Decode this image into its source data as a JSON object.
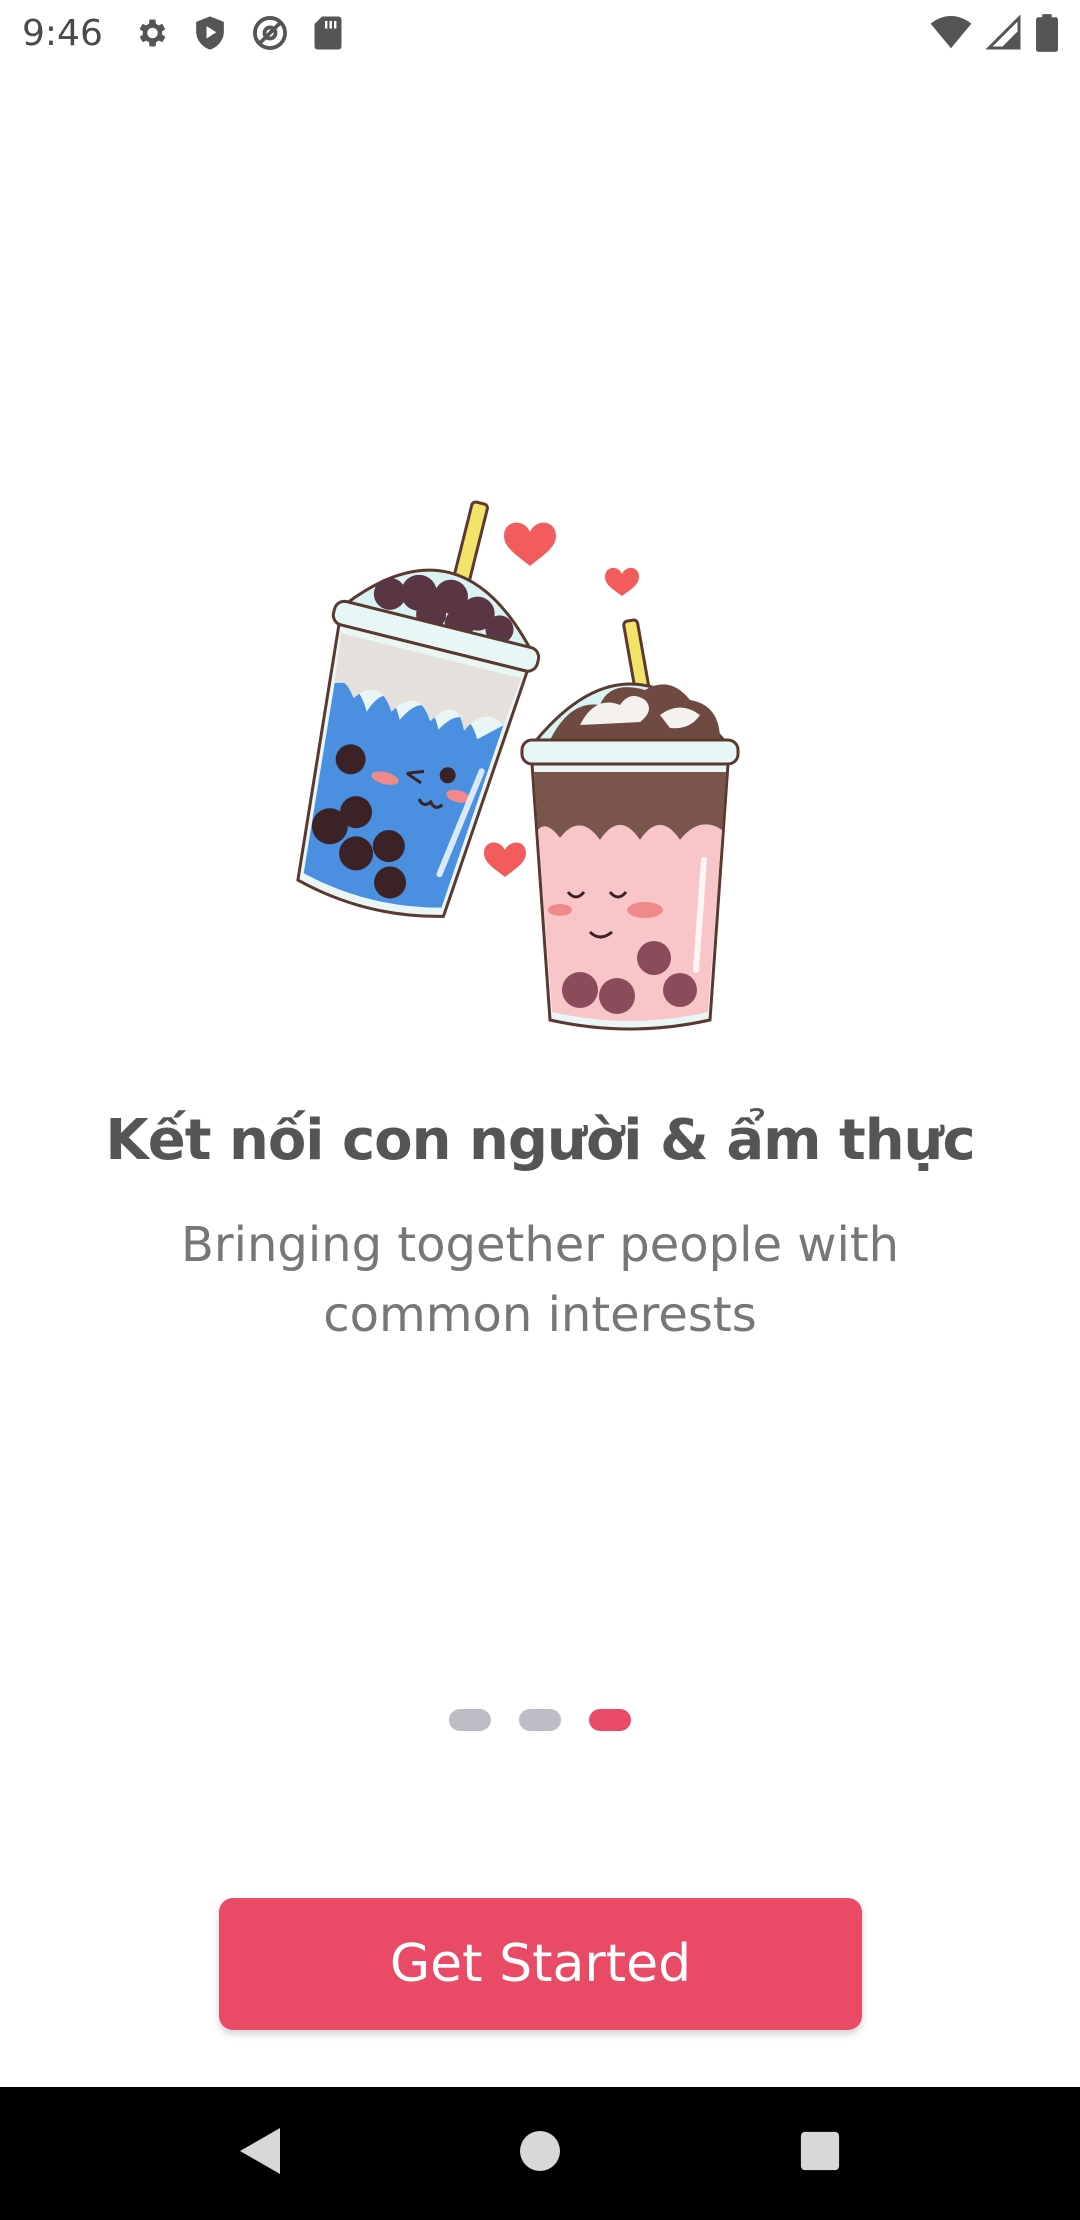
{
  "status_bar": {
    "time": "9:46",
    "left_icons": [
      "gear-icon",
      "shield-play-icon",
      "at-sync-icon",
      "sd-card-icon"
    ],
    "right_icons": [
      "wifi-icon",
      "signal-icon",
      "battery-icon"
    ]
  },
  "illustration": {
    "name": "bubble-tea-cups-illustration",
    "colors": {
      "blue_drink": "#4a8fe0",
      "pink_drink": "#f8c6c9",
      "chocolate": "#7a554c",
      "pearls": "#3a2226",
      "heart": "#f25c5c",
      "straw": "#f2e36a"
    }
  },
  "onboarding": {
    "headline": "Kết nối con người & ẩm thực",
    "subtitle": "Bringing together people with common interests",
    "page_count": 3,
    "active_page": 3
  },
  "cta": {
    "label": "Get Started"
  },
  "colors": {
    "accent": "#e94b67",
    "dot_inactive": "#bdbdc5",
    "headline": "#555555",
    "subtitle": "#777777"
  },
  "nav_bar": {
    "buttons": [
      "back-icon",
      "home-icon",
      "recents-icon"
    ]
  }
}
